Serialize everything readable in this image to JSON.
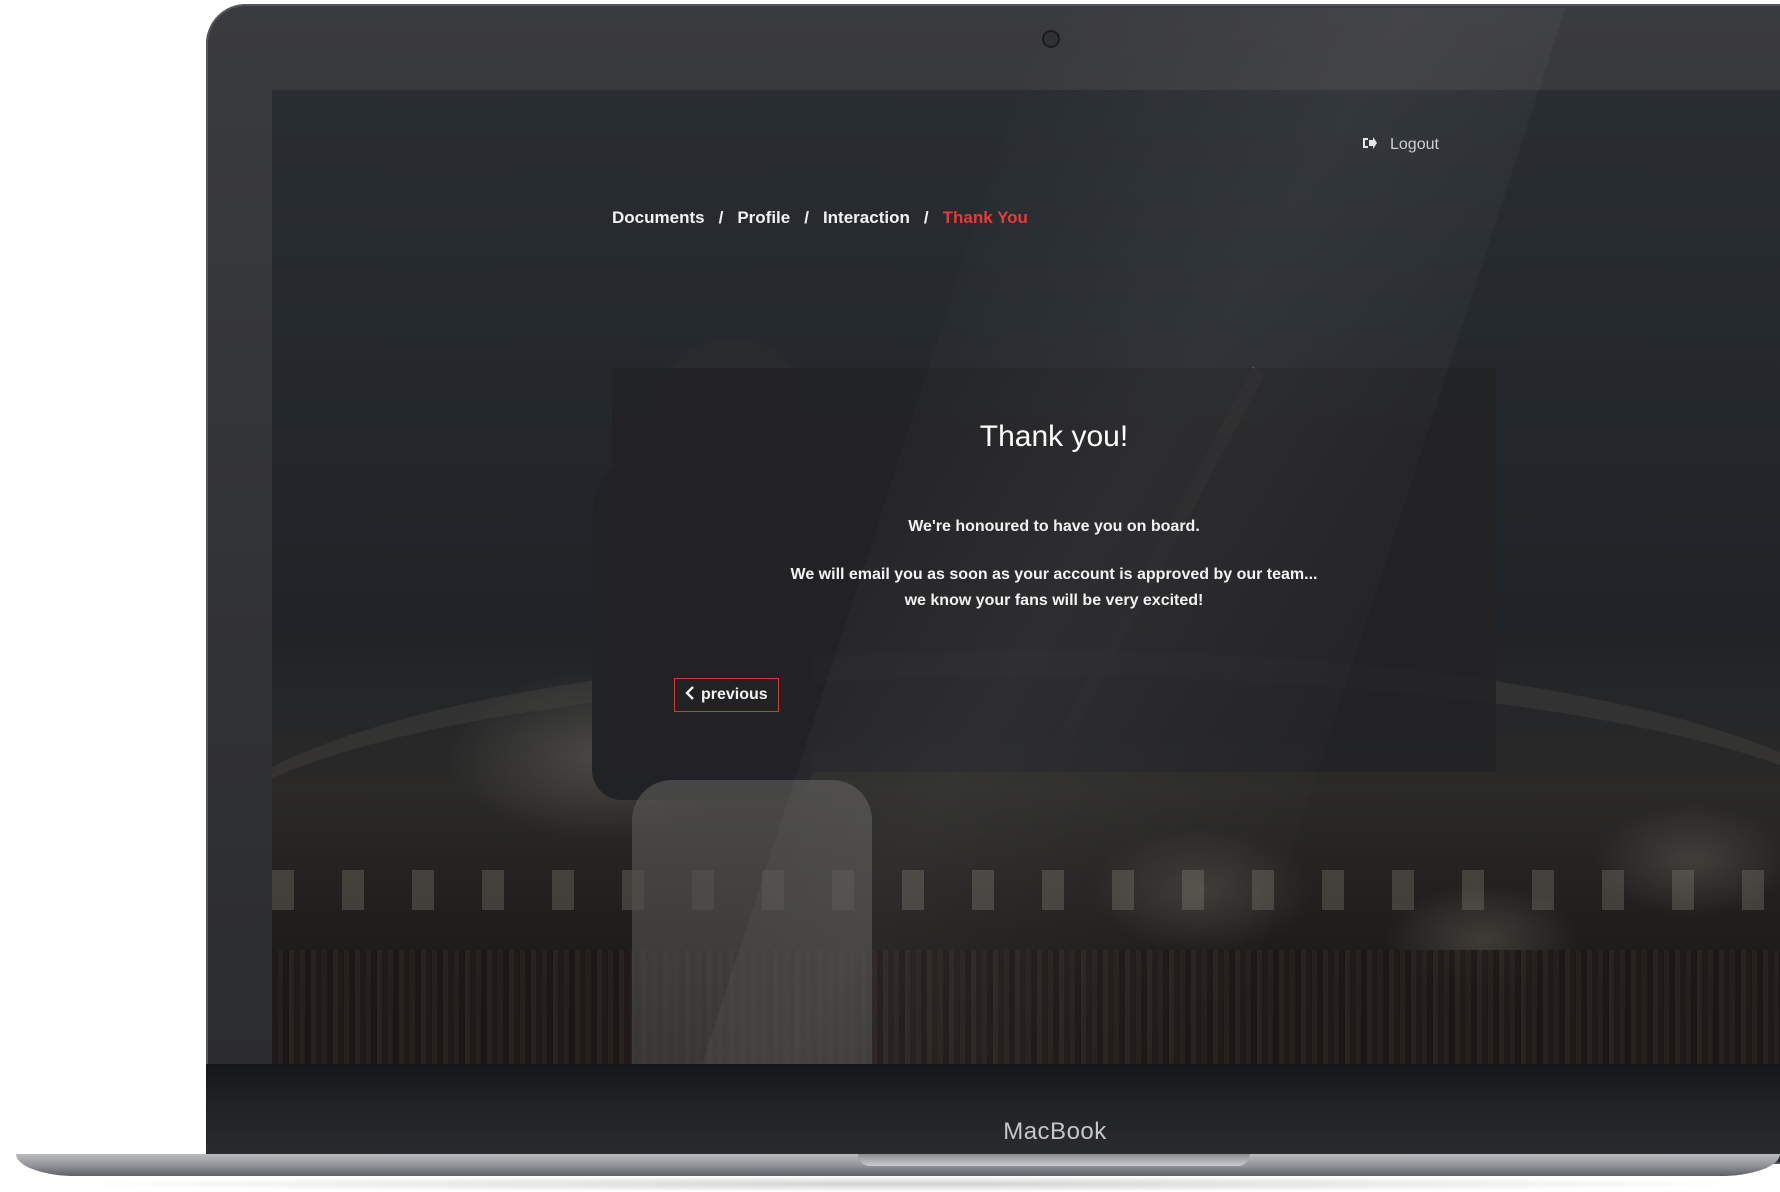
{
  "device": {
    "brand_label": "MacBook"
  },
  "header": {
    "logout_label": "Logout",
    "logout_icon": "sign-out-icon"
  },
  "breadcrumb": {
    "items": [
      {
        "label": "Documents",
        "active": false
      },
      {
        "label": "Profile",
        "active": false
      },
      {
        "label": "Interaction",
        "active": false
      },
      {
        "label": "Thank You",
        "active": true
      }
    ],
    "separator": "/"
  },
  "card": {
    "title": "Thank you!",
    "message_line1": "We're honoured to have you on board.",
    "message_line2": "We will email you as soon as your account is approved by our team...",
    "message_line3": "we know your fans will be very excited!",
    "previous_label": "previous",
    "previous_icon": "chevron-left-icon"
  },
  "colors": {
    "accent": "#e23b3b",
    "card_bg": "#222224",
    "text": "#f2f2f2"
  }
}
